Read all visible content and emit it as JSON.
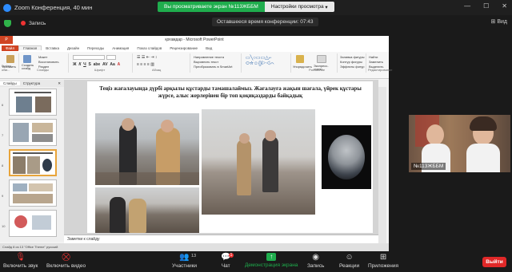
{
  "zoom": {
    "window_title": "Zoom Конференция, 40 мин",
    "share_banner": "Вы просматриваете экран №113ЖББМ",
    "share_settings": "Настройки просмотра",
    "recording": "Запись",
    "time_left": "Оставшееся время конференции: 07:43",
    "view": "Вид"
  },
  "ppt": {
    "title": "қоғамдар  -  Microsoft PowerPoint",
    "file_tab": "Файл",
    "tabs": [
      "Главная",
      "Вставка",
      "Дизайн",
      "Переходы",
      "Анимация",
      "Показ слайдов",
      "Рецензирование",
      "Вид"
    ],
    "ribbon": {
      "paste": "Вставить",
      "clipboard": "Буфер обм...",
      "create_slide": "Создать слайд",
      "layout": "Макет",
      "reset": "Восстановить",
      "section": "Раздел",
      "slides_group": "Слайды",
      "font_group": "Шрифт",
      "paragraph_group": "Абзац",
      "text_direction": "Направление текста",
      "align_text": "Выровнять текст",
      "smartart": "Преобразовать в SmartArt",
      "drawing_group": "Рисование",
      "arrange": "Упорядочить",
      "quick_styles": "Экспресс-стили",
      "shape_fill": "Заливка фигуры",
      "shape_outline": "Контур фигуры",
      "shape_effects": "Эффекты фигур",
      "find": "Найти",
      "replace": "Заменить",
      "select": "Выделить",
      "editing_group": "Редактирование"
    },
    "pane_tabs": [
      "Слайды",
      "Структура"
    ],
    "thumb_numbers": [
      "6",
      "7",
      "8",
      "9",
      "10"
    ],
    "slide_text": "Теңіз жағалауында дүрбі арқылы құстарды тамашалаймыз. Жағалауға жақын шағала, үйрек құстары жүрсе, алыс жерлерінен бір топ қоқиқаздарды байқадық",
    "notes": "Заметки к слайду",
    "status": "Слайд 8 из 13    \"Office Theme\"    русский"
  },
  "participant": {
    "name": "№113ЖББМ"
  },
  "toolbar": {
    "mute": "Включить звук",
    "video": "Включить видео",
    "participants": "Участники",
    "participants_count": "13",
    "chat": "Чат",
    "chat_badge": "1",
    "share": "Демонстрация экрана",
    "record": "Запись",
    "reactions": "Реакции",
    "apps": "Приложения",
    "exit": "Выйти"
  },
  "colors": {
    "zoom_green": "#1fad4d",
    "ppt_orange": "#d04423",
    "exit_red": "#e02828"
  }
}
